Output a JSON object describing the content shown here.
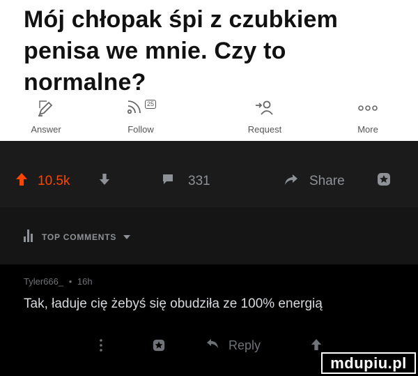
{
  "question": {
    "title": "Mój chłopak śpi z czubkiem penisa we mnie. Czy to normalne?"
  },
  "actions": {
    "answer_label": "Answer",
    "follow_label": "Follow",
    "follow_badge": "25",
    "request_label": "Request",
    "more_label": "More"
  },
  "post_bar": {
    "upvotes": "10.5k",
    "comments": "331",
    "share_label": "Share"
  },
  "comments_header": {
    "label": "TOP COMMENTS"
  },
  "comment": {
    "author": "Tyler666_",
    "separator": "•",
    "age": "16h",
    "text": "Tak, ładuje cię żebyś się obudziła ze 100% energią",
    "reply_label": "Reply"
  },
  "watermark": {
    "text": "mdupiu.pl"
  },
  "colors": {
    "upvote": "#ff4500",
    "muted": "#8e9196",
    "comment_text": "#d7dadc"
  }
}
